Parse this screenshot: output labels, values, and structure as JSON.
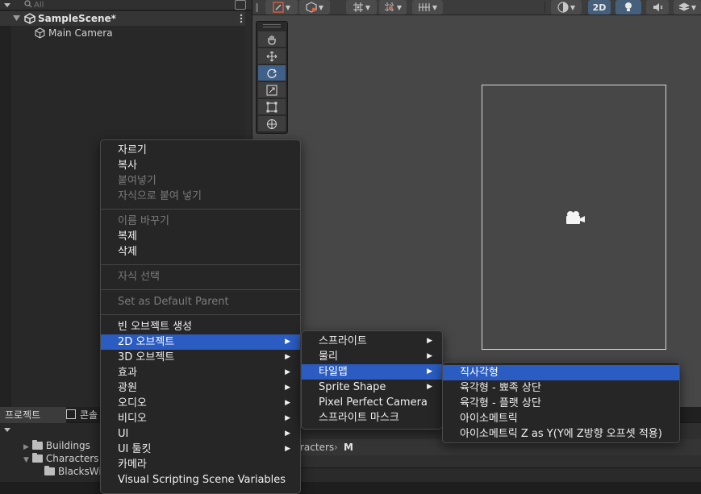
{
  "hierarchy": {
    "search_placeholder": "All",
    "scene_name": "SampleScene*",
    "items": [
      {
        "label": "Main Camera"
      }
    ]
  },
  "scene_toolbar": {
    "mode_2d_label": "2D",
    "buttons": [
      "gizmo-transform",
      "global-local",
      "snap-grid",
      "increment-snap",
      "layers",
      "shading-mode",
      "2d-mode",
      "lighting",
      "audio",
      "effects"
    ]
  },
  "tools": [
    "hand",
    "move",
    "rotate",
    "scale",
    "rect",
    "transform"
  ],
  "project_panel": {
    "tabs": [
      "프로젝트",
      "콘솔"
    ],
    "folders": [
      {
        "label": "Buildings",
        "expanded": false
      },
      {
        "label": "Characters",
        "expanded": true
      },
      {
        "label": "BlacksWin"
      }
    ],
    "breadcrumb": "racters",
    "breadcrumb_current": "M"
  },
  "context_menu": {
    "items": [
      {
        "label": "자르기"
      },
      {
        "label": "복사"
      },
      {
        "label": "붙여넣기",
        "disabled": true
      },
      {
        "label": "자식으로 붙여 넣기",
        "disabled": true
      },
      {
        "label": "이름 바꾸기",
        "disabled": true
      },
      {
        "label": "복제"
      },
      {
        "label": "삭제"
      },
      {
        "label": "자식 선택",
        "disabled": true
      },
      {
        "label": "Set as Default Parent",
        "disabled": true
      },
      {
        "label": "빈 오브젝트 생성"
      },
      {
        "label": "2D 오브젝트",
        "submenu": true,
        "highlighted": true
      },
      {
        "label": "3D 오브젝트",
        "submenu": true
      },
      {
        "label": "효과",
        "submenu": true
      },
      {
        "label": "광원",
        "submenu": true
      },
      {
        "label": "오디오",
        "submenu": true
      },
      {
        "label": "비디오",
        "submenu": true
      },
      {
        "label": "UI",
        "submenu": true
      },
      {
        "label": "UI 툴킷",
        "submenu": true
      },
      {
        "label": "카메라"
      },
      {
        "label": "Visual Scripting Scene Variables"
      }
    ]
  },
  "submenu_2d": {
    "items": [
      {
        "label": "스프라이트",
        "submenu": true
      },
      {
        "label": "물리",
        "submenu": true
      },
      {
        "label": "타일맵",
        "submenu": true,
        "highlighted": true
      },
      {
        "label": "Sprite Shape",
        "submenu": true
      },
      {
        "label": "Pixel Perfect Camera"
      },
      {
        "label": "스프라이트 마스크"
      }
    ]
  },
  "submenu_tilemap": {
    "items": [
      {
        "label": "직사각형",
        "highlighted": true
      },
      {
        "label": "육각형 - 뾰족 상단"
      },
      {
        "label": "육각형 - 플랫 상단"
      },
      {
        "label": "아이소메트릭"
      },
      {
        "label": "아이소메트릭 Z as Y(Y에 Z방향 오프셋 적용)"
      }
    ]
  },
  "colors": {
    "highlight": "#2a5cc2",
    "menu_bg": "#262626",
    "scene_bg": "#474747",
    "active_tool": "#3f6189"
  }
}
